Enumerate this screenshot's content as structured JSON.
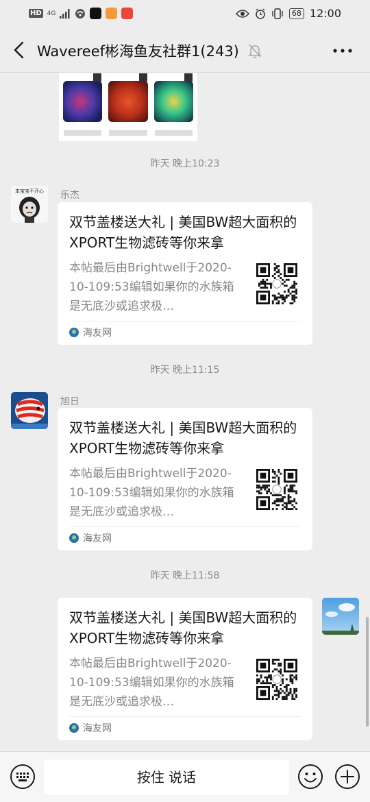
{
  "status_bar": {
    "hd": "HD",
    "network": "4G",
    "battery": "68",
    "time": "12:00",
    "icons": [
      "signal-icon",
      "wifi-icon",
      "tiktok-icon",
      "app-icon-orange",
      "app-icon-red",
      "eye-icon",
      "alarm-icon",
      "vibrate-icon",
      "battery-icon"
    ]
  },
  "header": {
    "title": "Wavereef彬海鱼友社群1(243)",
    "icons": [
      "back-icon",
      "mute-bell-icon",
      "more-icon"
    ]
  },
  "messages": [
    {
      "timestamp": "昨天 晚上10:23",
      "sender": "乐杰",
      "self": false,
      "card": {
        "title": "双节盖楼送大礼 | 美国BW超大面积的XPORT生物滤砖等你来拿",
        "desc": "本帖最后由Brightwell于2020-10-109:53编辑如果你的水族箱是无底沙或追求极…",
        "source": "海友网"
      }
    },
    {
      "timestamp": "昨天 晚上11:15",
      "sender": "旭日",
      "self": false,
      "card": {
        "title": "双节盖楼送大礼 | 美国BW超大面积的XPORT生物滤砖等你来拿",
        "desc": "本帖最后由Brightwell于2020-10-109:53编辑如果你的水族箱是无底沙或追求极…",
        "source": "海友网"
      }
    },
    {
      "timestamp": "昨天 晚上11:58",
      "sender": "",
      "self": true,
      "card": {
        "title": "双节盖楼送大礼 | 美国BW超大面积的XPORT生物滤砖等你来拿",
        "desc": "本帖最后由Brightwell于2020-10-109:53编辑如果你的水族箱是无底沙或追求极…",
        "source": "海友网"
      }
    }
  ],
  "input_bar": {
    "hold_to_talk": "按住 说话",
    "icons": [
      "keyboard-icon",
      "emoji-icon",
      "plus-icon"
    ]
  },
  "colors": {
    "background": "#ededed",
    "card": "#ffffff",
    "text_secondary": "#888888"
  }
}
